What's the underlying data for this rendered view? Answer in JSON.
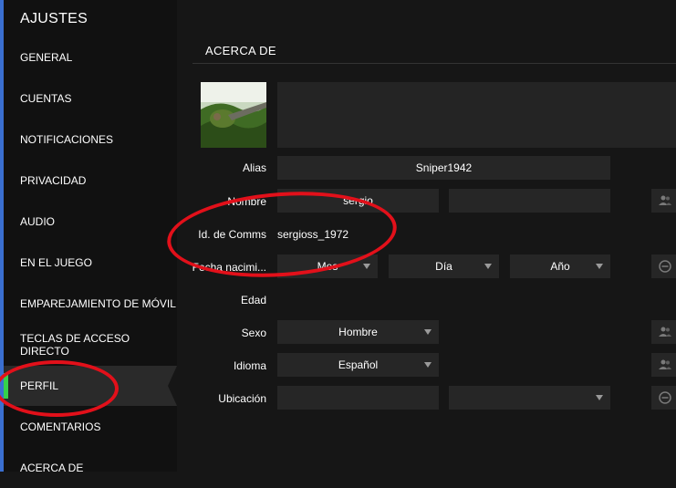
{
  "sidebar": {
    "title": "AJUSTES",
    "items": [
      {
        "label": "GENERAL"
      },
      {
        "label": "CUENTAS"
      },
      {
        "label": "NOTIFICACIONES"
      },
      {
        "label": "PRIVACIDAD"
      },
      {
        "label": "AUDIO"
      },
      {
        "label": "EN EL JUEGO"
      },
      {
        "label": "EMPAREJAMIENTO DE MÓVIL"
      },
      {
        "label": "TECLAS DE ACCESO DIRECTO"
      },
      {
        "label": "PERFIL"
      },
      {
        "label": "COMENTARIOS"
      },
      {
        "label": "ACERCA DE"
      }
    ],
    "active_item": "PERFIL"
  },
  "main": {
    "section_title": "ACERCA DE",
    "alias": {
      "label": "Alias",
      "value": "Sniper1942"
    },
    "nombre": {
      "label": "Nombre",
      "first_value": "sergio",
      "last_value": ""
    },
    "comms_id": {
      "label": "Id. de Comms",
      "value": "sergioss_1972"
    },
    "birth": {
      "label": "Fecha nacimi...",
      "month": "Mes",
      "day": "Día",
      "year": "Año"
    },
    "age": {
      "label": "Edad"
    },
    "sex": {
      "label": "Sexo",
      "value": "Hombre"
    },
    "language": {
      "label": "Idioma",
      "value": "Español"
    },
    "location": {
      "label": "Ubicación",
      "country": "",
      "region": ""
    }
  },
  "colors": {
    "accent_blue": "#3a6fd0",
    "active_green": "#35d04a",
    "annotation_red": "#e2101a"
  },
  "icons": {
    "privacy_toggle": "people-icon",
    "hidden_toggle": "minus-circle-icon",
    "dropdown": "chevron-down-icon"
  }
}
